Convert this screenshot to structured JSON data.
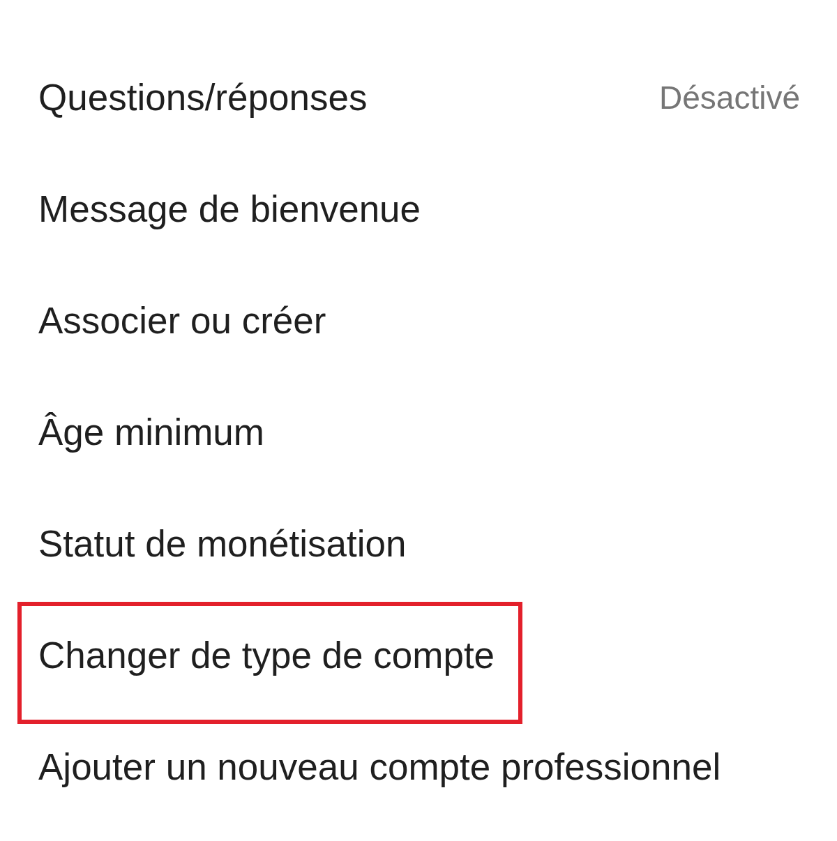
{
  "items": [
    {
      "label": "Questions/réponses",
      "value": "Désactivé",
      "highlighted": false
    },
    {
      "label": "Message de bienvenue",
      "highlighted": false
    },
    {
      "label": "Associer ou créer",
      "highlighted": false
    },
    {
      "label": "Âge minimum",
      "highlighted": false
    },
    {
      "label": "Statut de monétisation",
      "highlighted": false
    },
    {
      "label": "Changer de type de compte",
      "highlighted": true
    },
    {
      "label": "Ajouter un nouveau compte professionnel",
      "highlighted": false
    }
  ]
}
